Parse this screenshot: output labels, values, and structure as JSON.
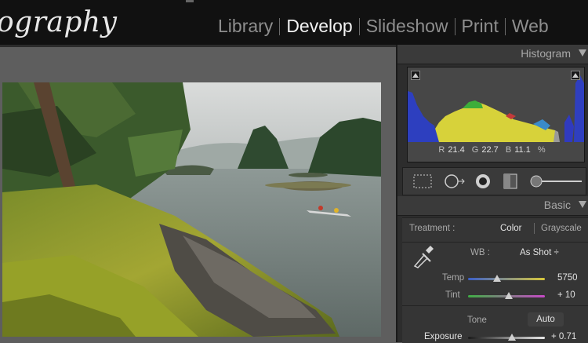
{
  "brand": {
    "text": "ography"
  },
  "modules": [
    {
      "label": "Library",
      "active": false
    },
    {
      "label": "Develop",
      "active": true
    },
    {
      "label": "Slideshow",
      "active": false
    },
    {
      "label": "Print",
      "active": false
    },
    {
      "label": "Web",
      "active": false
    }
  ],
  "histogram": {
    "title": "Histogram",
    "r_label": "R",
    "r_value": "21.4",
    "g_label": "G",
    "g_value": "22.7",
    "b_label": "B",
    "b_value": "11.1",
    "unit": "%"
  },
  "basic": {
    "title": "Basic",
    "treatment_label": "Treatment :",
    "color_label": "Color",
    "grayscale_label": "Grayscale",
    "wb_label": "WB :",
    "wb_value": "As Shot ÷",
    "temp_label": "Temp",
    "temp_value": "5750",
    "temp_position": 0.38,
    "tint_label": "Tint",
    "tint_value": "+ 10",
    "tint_position": 0.53,
    "tone_label": "Tone",
    "auto_label": "Auto",
    "exposure_label": "Exposure",
    "exposure_value": "+ 0.71",
    "exposure_position": 0.57
  },
  "colors": {
    "accent": "#f2f2f2",
    "panel": "#2d2d2d",
    "topbar": "#111111"
  }
}
